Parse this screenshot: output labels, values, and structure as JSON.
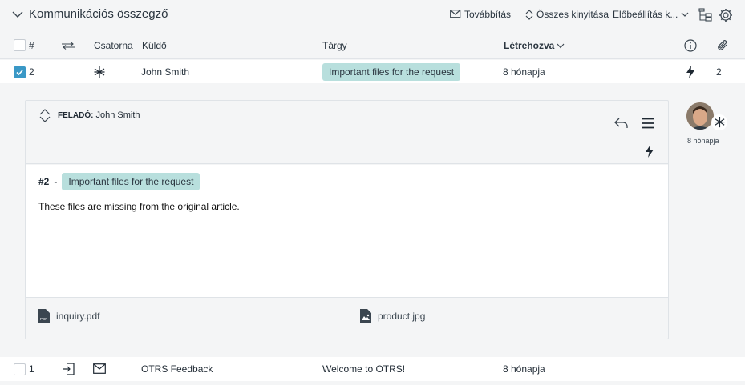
{
  "header": {
    "title": "Kommunikációs összegző",
    "forward_label": "Továbbítás",
    "expand_all_label": "Összes kinyitása",
    "presets_label": "Előbeállítás k..."
  },
  "columns": {
    "number": "#",
    "channel": "Csatorna",
    "sender": "Küldő",
    "subject": "Tárgy",
    "created": "Létrehozva"
  },
  "rows": [
    {
      "number": "2",
      "sender": "John Smith",
      "subject": "Important files for the request",
      "created": "8 hónapja",
      "attachments": "2",
      "checked": true
    },
    {
      "number": "1",
      "sender": "OTRS Feedback",
      "subject": "Welcome to OTRS!",
      "created": "8 hónapja",
      "checked": false
    }
  ],
  "article": {
    "from_label": "FELADÓ:",
    "from_name": "John Smith",
    "number": "#2",
    "separator": "-",
    "subject": "Important files for the request",
    "body": "These files are missing from the original article.",
    "age": "8 hónapja",
    "attachments": [
      {
        "name": "inquiry.pdf",
        "icon": "pdf-file-icon"
      },
      {
        "name": "product.jpg",
        "icon": "image-file-icon"
      }
    ]
  },
  "colors": {
    "accent": "#3a98c6",
    "tag_bg": "#b8dfdd",
    "panel_bg": "#f4f5f6"
  }
}
